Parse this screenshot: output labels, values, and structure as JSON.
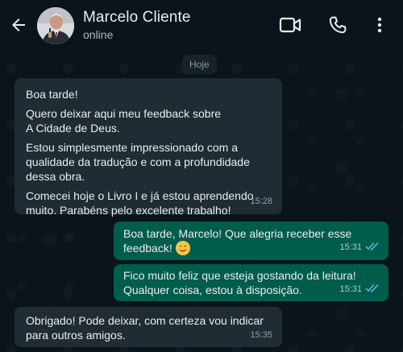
{
  "header": {
    "contact_name": "Marcelo Cliente",
    "status": "online",
    "icons": [
      "back-arrow-icon",
      "video-call-icon",
      "phone-icon",
      "more-vert-icon"
    ]
  },
  "chat": {
    "date_chip": "Hoje",
    "messages": [
      {
        "direction": "incoming",
        "paragraphs": [
          "Boa tarde!",
          "Quero deixar aqui meu feedback sobre\nA Cidade de Deus.",
          "Estou simplesmente impressionado com a\nqualidade da tradução e com a profundidade\ndessa obra.",
          "Comecei hoje o Livro I e já estou aprendendo\nmuito. Parabéns pelo excelente trabalho!"
        ],
        "time": "15:28"
      },
      {
        "direction": "outgoing",
        "line1": "Boa tarde, Marcelo! Que alegria receber esse",
        "line2": "feedback!",
        "emoji": "smiling-face-icon",
        "time": "15:31",
        "read": true
      },
      {
        "direction": "outgoing",
        "paragraphs": [
          "Fico muito feliz que esteja gostando da leitura!\nQualquer coisa, estou à disposição."
        ],
        "time": "15:31",
        "read": true
      },
      {
        "direction": "incoming",
        "paragraphs": [
          "Obrigado! Pode deixar, com certeza vou indicar\npara outros amigos."
        ],
        "time": "15:35"
      }
    ]
  },
  "colors": {
    "background": "#0b141a",
    "incoming_bubble": "#202c33",
    "outgoing_bubble": "#005c4b",
    "read_ticks": "#53bdeb"
  }
}
